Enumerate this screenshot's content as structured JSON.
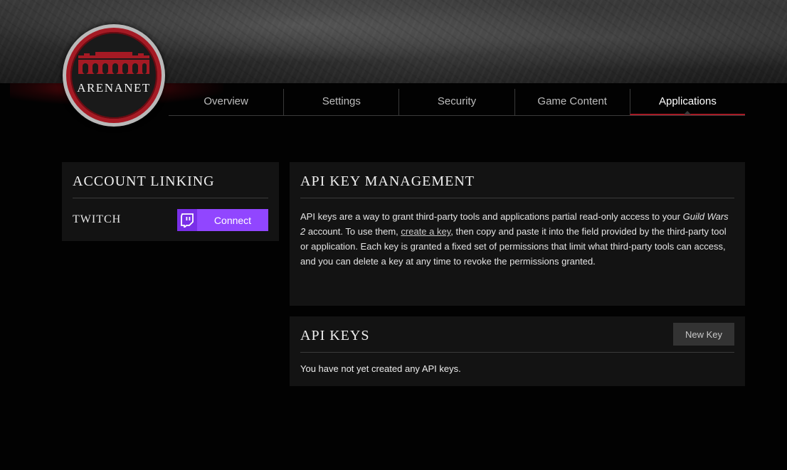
{
  "logo": {
    "text": "ARENANET"
  },
  "tabs": [
    {
      "label": "Overview",
      "active": false
    },
    {
      "label": "Settings",
      "active": false
    },
    {
      "label": "Security",
      "active": false
    },
    {
      "label": "Game Content",
      "active": false
    },
    {
      "label": "Applications",
      "active": true
    }
  ],
  "account_linking": {
    "title": "ACCOUNT LINKING",
    "twitch_label": "TWITCH",
    "connect_label": "Connect",
    "twitch_icon": "twitch-icon"
  },
  "api_management": {
    "title": "API KEY MANAGEMENT",
    "desc_part1": "API keys are a way to grant third-party tools and applications partial read-only access to your ",
    "desc_game": "Guild Wars 2",
    "desc_part2": " account. To use them, ",
    "desc_link": "create a key",
    "desc_part3": ", then copy and paste it into the field provided by the third-party tool or application. Each key is granted a fixed set of permissions that limit what third-party tools can access, and you can delete a key at any time to revoke the permissions granted."
  },
  "api_keys": {
    "title": "API KEYS",
    "new_key_label": "New Key",
    "empty_message": "You have not yet created any API keys."
  },
  "colors": {
    "accent_red": "#a51a24",
    "twitch_purple": "#9146ff",
    "panel_bg": "#131313",
    "page_bg": "#020202"
  }
}
